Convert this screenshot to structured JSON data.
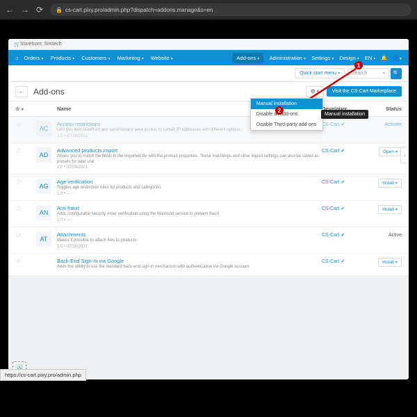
{
  "browser": {
    "url": "cs-cart.pixy.pro/admin.php?dispatch=addons.manage&s=en",
    "status_url": "https://cs-cart.pixy.pro/admin.php"
  },
  "storefront": {
    "label": "Storefront: Simtech"
  },
  "topnav": {
    "left": [
      "Orders",
      "Products",
      "Customers",
      "Marketing",
      "Website"
    ],
    "right_active": "Add-ons",
    "right": [
      "Administration",
      "Settings",
      "Design"
    ],
    "lang": "EN"
  },
  "quickbar": {
    "quick_start": "Quick start menu",
    "search_placeholder": "Search"
  },
  "page": {
    "title": "Add-ons",
    "marketplace_btn": "Visit the CS-Cart Marketplace"
  },
  "gear_menu": {
    "items": [
      "Manual installation",
      "Disable all add-ons",
      "Disable Third-party add-ons"
    ],
    "tooltip": "Manual installation"
  },
  "table": {
    "headers": {
      "name": "Name",
      "developer": "Developer",
      "status": "Status"
    }
  },
  "addons": [
    {
      "code": "AC",
      "name": "Access restrictions",
      "desc": "Lets you limit storefront and administrator area access to certain IP addresses with different options",
      "ver": "1.0 • 07/28/2021",
      "dev": "CS-Cart",
      "status": "Activate",
      "disabled": true
    },
    {
      "code": "AD",
      "name": "Advanced products import",
      "desc": "Allows you to match the fields in the imported file with the product properties. These matchings and other import settings can also be saved as presets for later use.",
      "ver": "1.0 • 07/28/2021",
      "dev": "CS-Cart",
      "status": "Open",
      "status_type": "btn"
    },
    {
      "code": "AG",
      "name": "Age verification",
      "desc": "Toggles age restriction rules for products and categories",
      "ver": "1.0 • —",
      "dev": "CS-Cart",
      "status": "Install",
      "status_type": "btn"
    },
    {
      "code": "AN",
      "name": "Anti fraud",
      "desc": "Adds configurable security order verification using the Maxmind service to prevent fraud",
      "ver": "1.0 • —",
      "dev": "CS-Cart",
      "status": "Install",
      "status_type": "btn"
    },
    {
      "code": "AT",
      "name": "Attachments",
      "desc": "Makes it possible to attach files to products",
      "ver": "1.0 • 07/28/2021",
      "dev": "CS-Cart",
      "status": "Active",
      "status_type": "plain"
    },
    {
      "code": "",
      "name": "Back-End Sign-In via Google",
      "desc": "Adds the ability to use the standard back-end sign-in mechanism with authentication via Google account.",
      "ver": "",
      "dev": "CS-Cart",
      "status": "Install",
      "status_type": "btn"
    }
  ],
  "callouts": {
    "one": "1",
    "two": "2"
  }
}
